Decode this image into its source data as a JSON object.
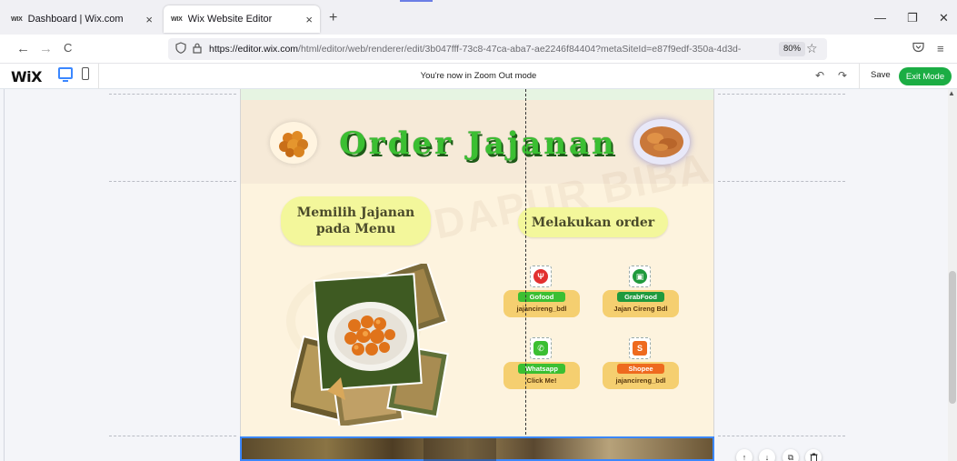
{
  "browser": {
    "tabs": [
      {
        "favicon": "WIX",
        "title": "Dashboard | Wix.com",
        "close": "×"
      },
      {
        "favicon": "WIX",
        "title": "Wix Website Editor",
        "close": "×"
      }
    ],
    "new_tab": "+",
    "window_controls": {
      "minimize": "—",
      "restore": "❐",
      "close": "✕"
    },
    "nav": {
      "back": "←",
      "forward": "→",
      "reload": "C"
    },
    "url_host": "https://editor.wix.com",
    "url_path": "/html/editor/web/renderer/edit/3b047fff-73c8-47ca-aba7-ae2246f84404?metaSiteId=e87f9edf-350a-4d3d-",
    "zoom": "80%",
    "icons": {
      "shield": "shield-icon",
      "lock": "lock-icon",
      "star": "bookmark-star-icon",
      "pocket": "pocket-icon",
      "menu": "hamburger-menu-icon"
    }
  },
  "editor": {
    "logo": "WiX",
    "zoom_note": "You're now in Zoom Out mode",
    "undo": "↶",
    "redo": "↷",
    "save": "Save",
    "exit": "Exit Mode"
  },
  "site": {
    "headline": "Order Jajanan",
    "pill_left": "Memilih Jajanan pada Menu",
    "pill_right": "Melakukan order",
    "watermark": "DAPUR BIBA",
    "orders": [
      {
        "service": "Gofood",
        "handle": "jajancireng_bdl",
        "color": "#3bbf32",
        "icon_color": "#e23030",
        "icon": "fork-knife-icon"
      },
      {
        "service": "GrabFood",
        "handle": "Jajan Cireng Bdl",
        "color": "#1f9a3d",
        "icon_color": "#1f9a3d",
        "icon": "grabfood-icon"
      },
      {
        "service": "Whatsapp",
        "handle": "Click Me!",
        "color": "#3bbf32",
        "icon_color": "#3bbf32",
        "icon": "whatsapp-icon"
      },
      {
        "service": "Shopee",
        "handle": "jajancireng_bdl",
        "color": "#ee6a1f",
        "icon_color": "#ee6a1f",
        "icon": "shopee-bag-icon"
      }
    ]
  },
  "floating_actions": [
    "↑",
    "↓",
    "⧉",
    "🗑"
  ]
}
